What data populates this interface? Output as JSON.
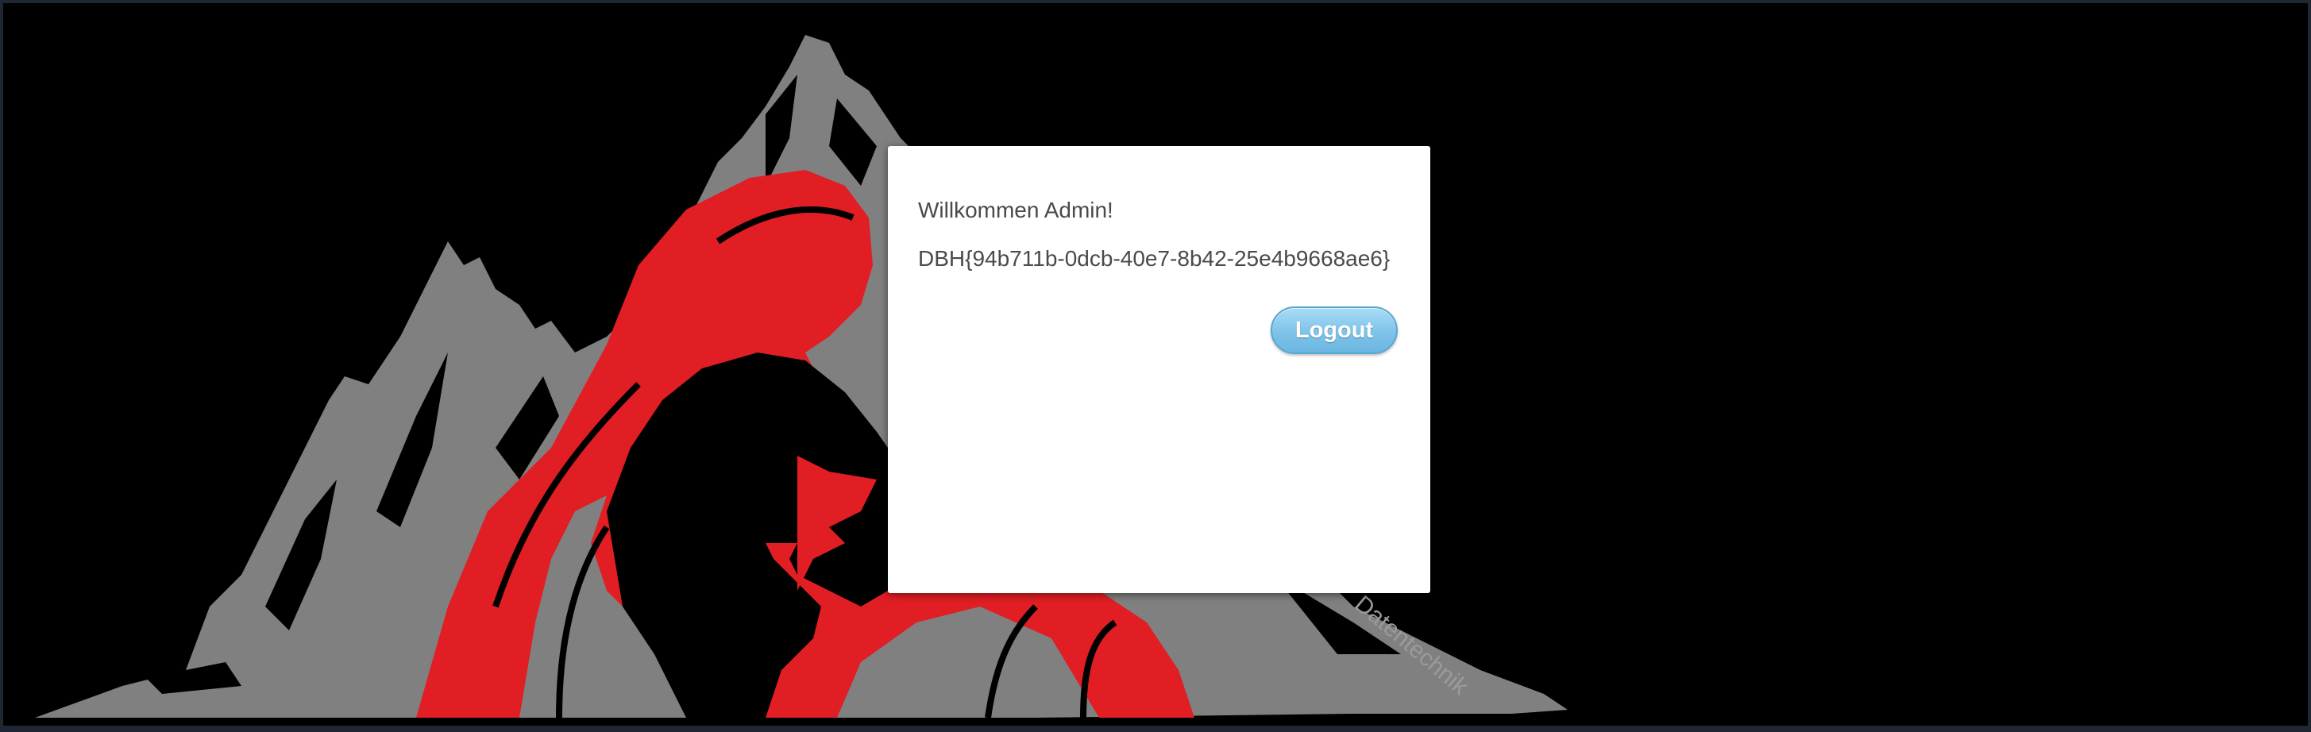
{
  "dialog": {
    "welcome_text": "Willkommen Admin!",
    "flag_text": "DBH{94b711b-0dcb-40e7-8b42-25e4b9668ae6}",
    "logout_label": "Logout"
  },
  "background": {
    "watermark": "Datentechnik",
    "colors": {
      "page": "#000000",
      "mountains": "#808080",
      "hood": "#e01e24",
      "dialog": "#ffffff",
      "button": "#7ec3ea"
    },
    "icon": "hooded-figure-mountains-logo"
  }
}
